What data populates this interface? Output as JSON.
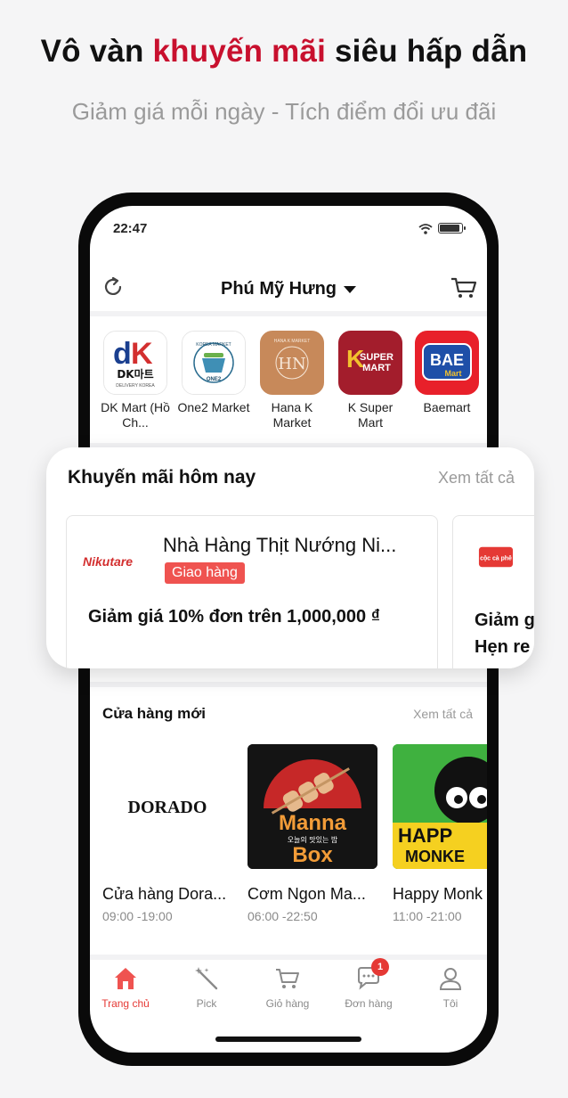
{
  "promo_banner": {
    "headline_pre": "Vô vàn ",
    "headline_highlight": "khuyến mãi",
    "headline_post": " siêu hấp dẫn",
    "subheadline": "Giảm giá mỗi ngày - Tích điểm đổi ưu đãi"
  },
  "status_bar": {
    "time": "22:47"
  },
  "app_bar": {
    "location": "Phú Mỹ Hưng"
  },
  "stores": [
    {
      "name": "DK Mart (Hồ Ch...",
      "logo_text": "DK마트",
      "logo_sub": "DELIVERY KOREA"
    },
    {
      "name": "One2 Market",
      "logo_text": "ONE2",
      "logo_sub": "KOREA MARKET"
    },
    {
      "name": "Hana K Market",
      "logo_text": "HN",
      "logo_sub": "HANA K MARKET"
    },
    {
      "name": "K Super Mart",
      "logo_text": "SUPER",
      "logo_sub": "MART"
    },
    {
      "name": "Baemart",
      "logo_text": "BAE",
      "logo_sub": "Mart"
    }
  ],
  "promotions": {
    "title": "Khuyến mãi hôm nay",
    "see_all": "Xem tất cả",
    "items": [
      {
        "store": "Nhà Hàng Thịt Nướng Ni...",
        "tag": "Giao hàng",
        "desc": "Giảm giá 10% đơn trên 1,000,000 ₫",
        "logo_text": "Nikutare"
      },
      {
        "store": "",
        "tag": "",
        "desc": "Giảm g Hẹn re",
        "logo_text": "cộc cà phê"
      }
    ]
  },
  "new_stores": {
    "title": "Cửa hàng mới",
    "see_all": "Xem tất cả",
    "items": [
      {
        "name": "Cửa hàng Dora...",
        "hours": "09:00 -19:00",
        "logo_text": "DORADO"
      },
      {
        "name": "Cơm Ngon Ma...",
        "hours": "06:00 -22:50",
        "logo_text": "Manna",
        "logo_text2": "Box",
        "logo_sub": "오늘의 맛있는 밥"
      },
      {
        "name": "Happy Monk",
        "hours": "11:00 -21:00",
        "logo_text": "HAPP",
        "logo_text2": "MONKE"
      }
    ]
  },
  "tabs": [
    {
      "label": "Trang chủ",
      "icon": "home-icon",
      "active": true
    },
    {
      "label": "Pick",
      "icon": "magic-wand-icon"
    },
    {
      "label": "Giỏ hàng",
      "icon": "cart-icon"
    },
    {
      "label": "Đơn hàng",
      "icon": "chat-icon",
      "badge": "1"
    },
    {
      "label": "Tôi",
      "icon": "user-icon"
    }
  ],
  "colors": {
    "accent": "#e53935",
    "brand_red": "#c8102e",
    "tag": "#ef5350"
  }
}
